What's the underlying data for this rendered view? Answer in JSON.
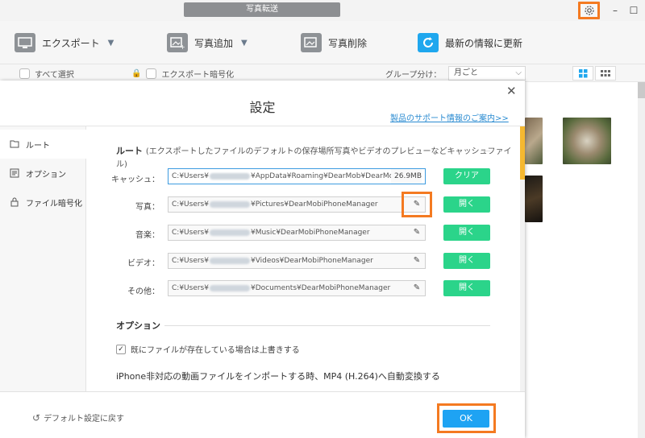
{
  "titlebar": {
    "title": "写真転送"
  },
  "toolbar": {
    "export_label": "エクスポート",
    "add_photo_label": "写真追加",
    "delete_photo_label": "写真削除",
    "refresh_label": "最新の情報に更新"
  },
  "selectbar": {
    "select_all": "すべて選択",
    "export_encrypt": "エクスポート暗号化",
    "group_by_label": "グループ分け：",
    "group_by_value": "月ごと"
  },
  "dialog": {
    "title": "設定",
    "support_link": "製品のサポート情報のご案内>>",
    "sidebar": [
      {
        "label": "ルート"
      },
      {
        "label": "オプション"
      },
      {
        "label": "ファイル暗号化"
      }
    ],
    "route_section": {
      "heading": "ルート",
      "subheading": "(エクスポートしたファイルのデフォルトの保存場所写真やビデオのプレビューなどキャッシュファイル)"
    },
    "rows": [
      {
        "label": "キャッシュ：",
        "path_prefix": "C:¥Users¥",
        "path_suffix": "¥AppData¥Roaming¥DearMob¥DearMobi…",
        "size": "26.9MB",
        "button": "クリア"
      },
      {
        "label": "写真：",
        "path_prefix": "C:¥Users¥",
        "path_suffix": "¥Pictures¥DearMobiPhoneManager",
        "button": "開く"
      },
      {
        "label": "音楽：",
        "path_prefix": "C:¥Users¥",
        "path_suffix": "¥Music¥DearMobiPhoneManager",
        "button": "開く"
      },
      {
        "label": "ビデオ：",
        "path_prefix": "C:¥Users¥",
        "path_suffix": "¥Videos¥DearMobiPhoneManager",
        "button": "開く"
      },
      {
        "label": "その他：",
        "path_prefix": "C:¥Users¥",
        "path_suffix": "¥Documents¥DearMobiPhoneManager",
        "button": "開く"
      }
    ],
    "option_section": {
      "heading": "オプション",
      "overwrite_label": "既にファイルが存在している場合は上書きする",
      "convert_text": "iPhone非対応の動画ファイルをインポートする時、MP4 (H.264)へ自動変換する"
    },
    "footer": {
      "default_label": "デフォルト設定に戻す",
      "ok_label": "OK"
    }
  },
  "colors": {
    "accent_green": "#2bd48a",
    "ok_blue": "#1ea3f3",
    "highlight_orange": "#f47a21",
    "link_blue": "#2a8bd1"
  }
}
